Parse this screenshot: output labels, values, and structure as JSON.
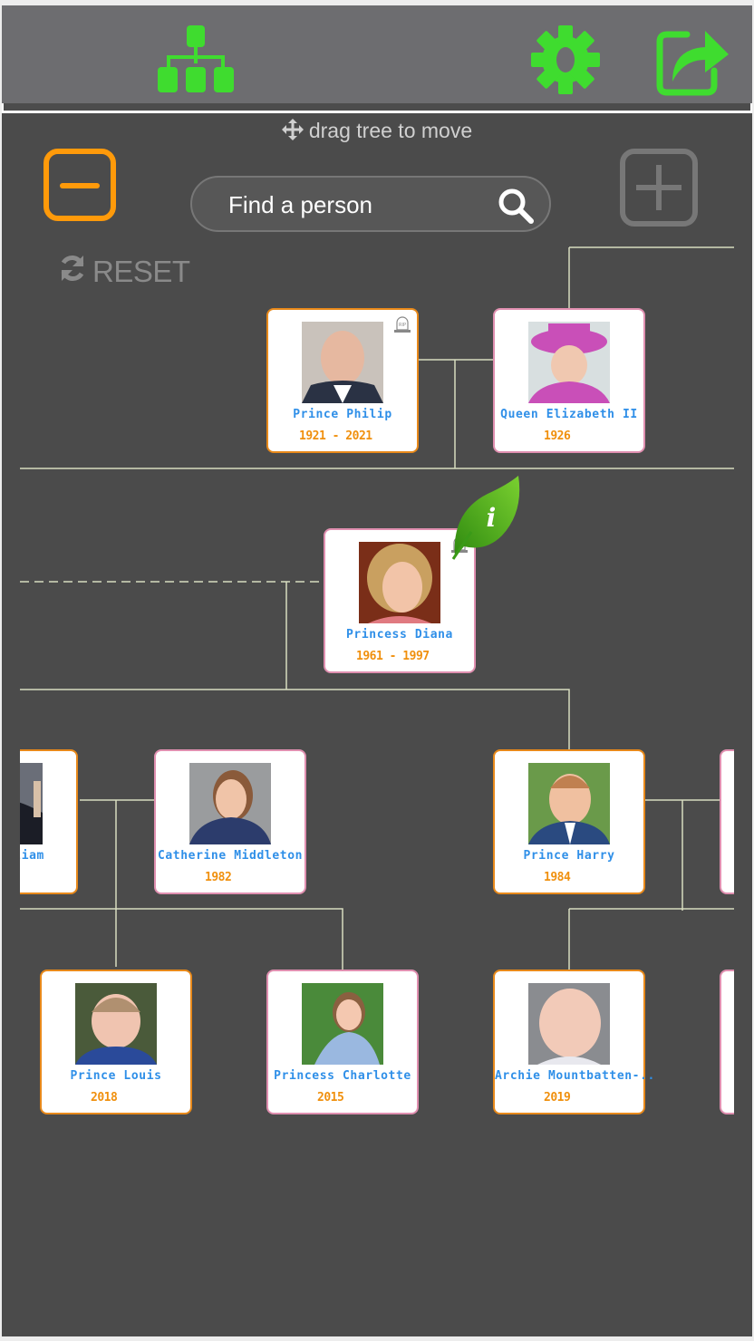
{
  "toolbar": {
    "tree_view_icon": "family-tree-icon",
    "settings_icon": "gear-icon",
    "share_icon": "share-icon",
    "accent_color": "#3fdc2f"
  },
  "controls": {
    "drag_hint": "drag tree to move",
    "search_placeholder": "Find a person",
    "reset_label": "RESET",
    "zoom_out_color": "#ff9a0a",
    "zoom_in_color": "#777777"
  },
  "people": [
    {
      "id": "philip",
      "name": "Prince Philip",
      "dates": "1921 - 2021",
      "sex": "male",
      "deceased": true
    },
    {
      "id": "elizabeth",
      "name": "Queen Elizabeth II",
      "dates": "1926",
      "sex": "female",
      "deceased": false
    },
    {
      "id": "diana",
      "name": "Princess Diana",
      "dates": "1961 - 1997",
      "sex": "female",
      "deceased": true
    },
    {
      "id": "william",
      "name": "liam",
      "dates": "",
      "sex": "male",
      "deceased": false
    },
    {
      "id": "catherine",
      "name": "Catherine Middleton",
      "dates": "1982",
      "sex": "female",
      "deceased": false
    },
    {
      "id": "harry",
      "name": "Prince Harry",
      "dates": "1984",
      "sex": "male",
      "deceased": false
    },
    {
      "id": "louis",
      "name": "Prince Louis",
      "dates": "2018",
      "sex": "male",
      "deceased": false
    },
    {
      "id": "charlotte",
      "name": "Princess Charlotte",
      "dates": "2015",
      "sex": "female",
      "deceased": false
    },
    {
      "id": "archie",
      "name": "Archie Mountbatten-..",
      "dates": "2019",
      "sex": "male",
      "deceased": false
    }
  ],
  "info_badge": "i",
  "rip_label": "RIP"
}
